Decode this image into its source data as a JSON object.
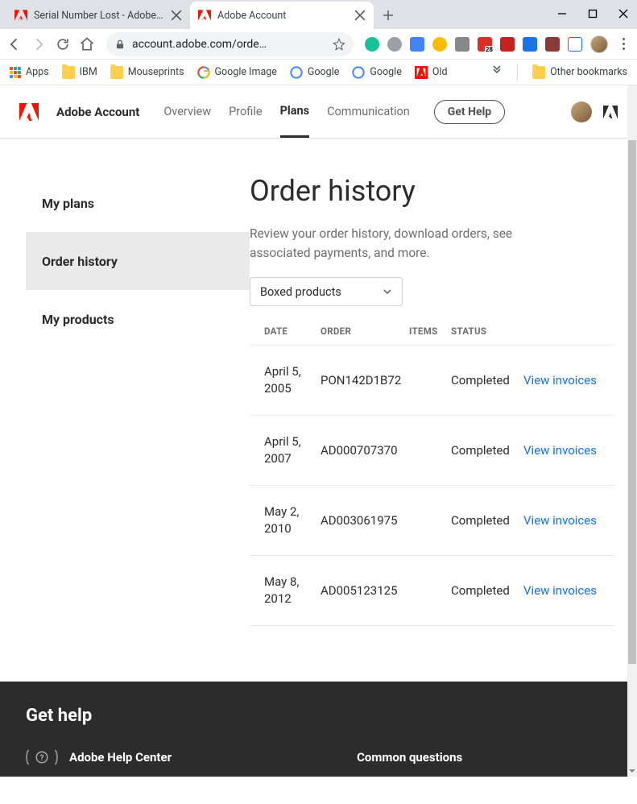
{
  "window": {
    "tabs": [
      {
        "title": "Serial Number Lost - Adobe Supp"
      },
      {
        "title": "Adobe Account"
      }
    ]
  },
  "toolbar": {
    "url": "account.adobe.com/orde…"
  },
  "bookmarks": {
    "apps": "Apps",
    "items": [
      "IBM",
      "Mouseprints",
      "Google Image",
      "Google",
      "Google",
      "Old"
    ],
    "other": "Other bookmarks"
  },
  "header": {
    "brand": "Adobe Account",
    "nav": [
      "Overview",
      "Profile",
      "Plans",
      "Communication"
    ],
    "active_index": 2,
    "get_help": "Get Help"
  },
  "sidebar": {
    "items": [
      "My plans",
      "Order history",
      "My products"
    ],
    "active_index": 1
  },
  "content": {
    "title": "Order history",
    "description": "Review your order history, download orders, see associated payments, and more.",
    "dropdown_label": "Boxed products",
    "columns": {
      "date": "DATE",
      "order": "ORDER",
      "items": "ITEMS",
      "status": "STATUS"
    },
    "rows": [
      {
        "date": "April 5, 2005",
        "order": "PON142D1B72",
        "items": "",
        "status": "Completed",
        "action": "View invoices"
      },
      {
        "date": "April 5, 2007",
        "order": "AD000707370",
        "items": "",
        "status": "Completed",
        "action": "View invoices"
      },
      {
        "date": "May 2, 2010",
        "order": "AD003061975",
        "items": "",
        "status": "Completed",
        "action": "View invoices"
      },
      {
        "date": "May 8, 2012",
        "order": "AD005123125",
        "items": "",
        "status": "Completed",
        "action": "View invoices"
      }
    ]
  },
  "footer": {
    "title": "Get help",
    "col1": "Adobe Help Center",
    "col2": "Common questions"
  }
}
